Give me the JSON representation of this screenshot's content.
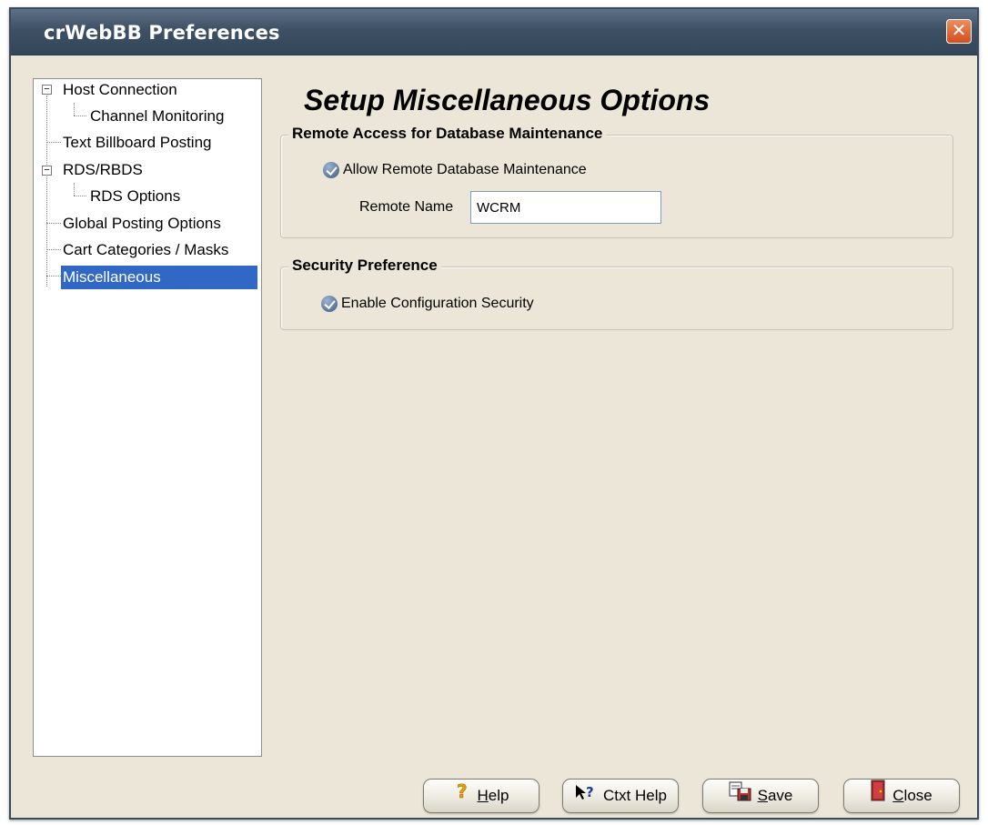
{
  "window": {
    "title": "crWebBB Preferences",
    "close_glyph": "✕"
  },
  "tree": {
    "items": [
      {
        "label": "Host Connection"
      },
      {
        "label": "Channel Monitoring"
      },
      {
        "label": "Text Billboard Posting"
      },
      {
        "label": "RDS/RBDS"
      },
      {
        "label": "RDS Options"
      },
      {
        "label": "Global Posting Options"
      },
      {
        "label": "Cart Categories / Masks"
      },
      {
        "label": "Miscellaneous",
        "selected": true
      }
    ],
    "expander_glyph": "−"
  },
  "main": {
    "heading": "Setup Miscellaneous Options",
    "remote_group": {
      "title": "Remote Access for Database Maintenance",
      "allow_label": "Allow Remote Database Maintenance",
      "allow_checked": true,
      "remote_name_label": "Remote Name",
      "remote_name_value": "WCRM"
    },
    "security_group": {
      "title": "Security Preference",
      "enable_label": "Enable Configuration Security",
      "enable_checked": true
    }
  },
  "buttons": {
    "help": {
      "accel": "H",
      "rest": "elp",
      "icon": "question-icon"
    },
    "ctxt_help": {
      "label": "Ctxt Help",
      "icon": "context-help-icon"
    },
    "save": {
      "accel": "S",
      "rest": "ave",
      "icon": "save-icon"
    },
    "close": {
      "accel": "C",
      "rest": "lose",
      "icon": "exit-door-icon"
    }
  },
  "colors": {
    "accent": "#3168c6",
    "titlebar": "#3e5064",
    "dialog_bg": "#ece6d8"
  }
}
